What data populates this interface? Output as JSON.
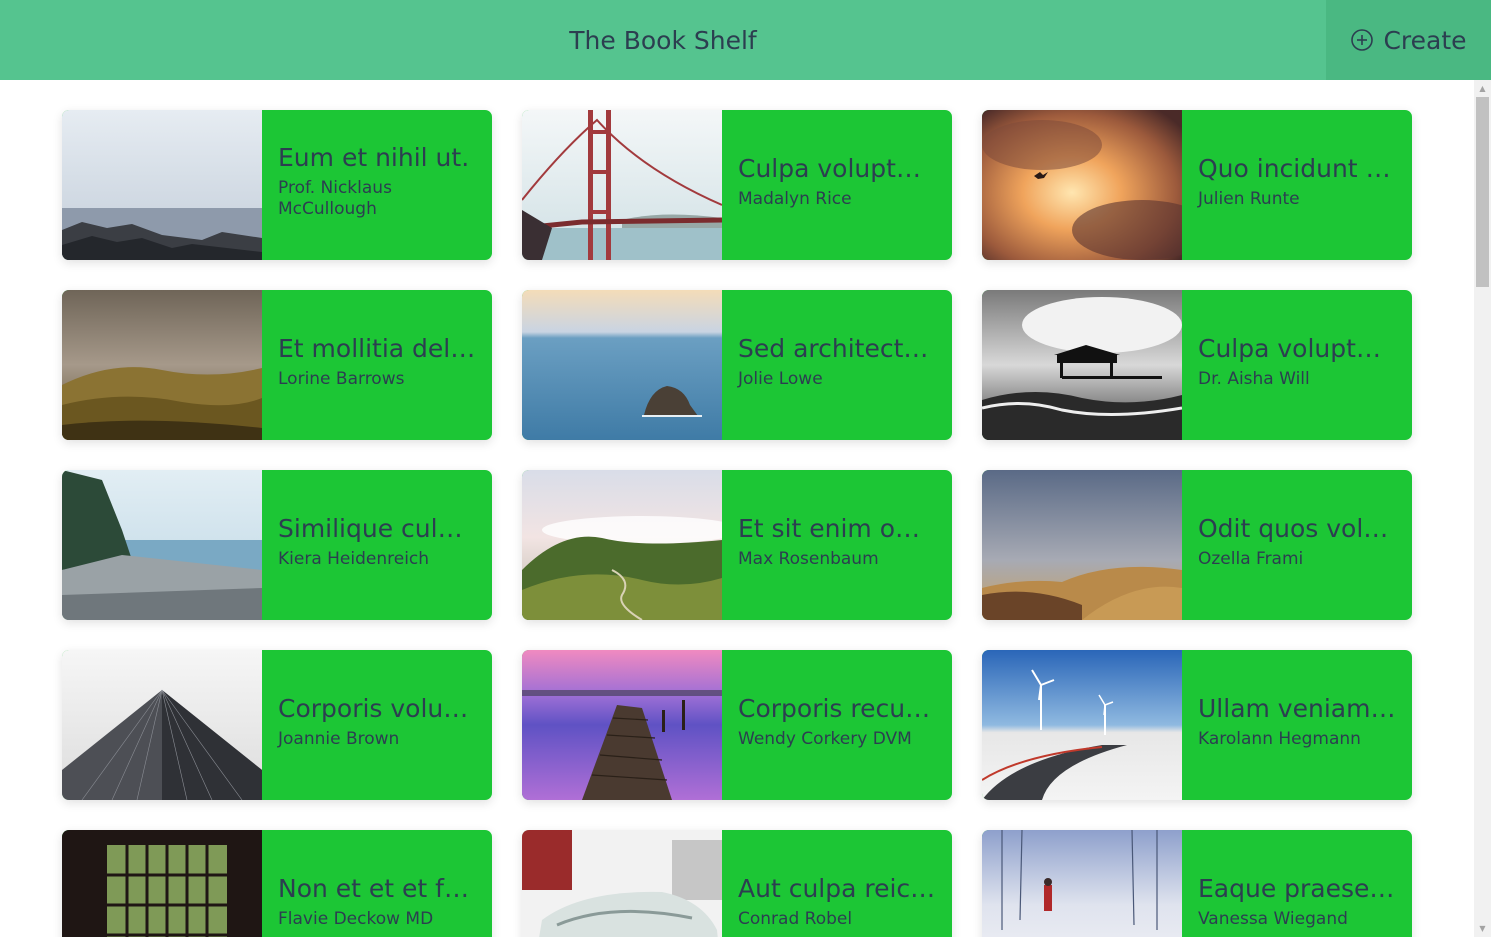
{
  "header": {
    "title": "The Book Shelf",
    "create_label": "Create",
    "background": "#55c48f",
    "create_background": "#4ab882"
  },
  "card_color": "#1cc635",
  "books": [
    {
      "title": "Eum et nihil ut.",
      "author": "Prof. Nicklaus McCullough",
      "image": "rocky-coast"
    },
    {
      "title": "Culpa voluptat...",
      "author": "Madalyn Rice",
      "image": "golden-gate-bridge"
    },
    {
      "title": "Quo incidunt a...",
      "author": "Julien Runte",
      "image": "sunset-clouds"
    },
    {
      "title": "Et mollitia dele...",
      "author": "Lorine Barrows",
      "image": "misty-hills"
    },
    {
      "title": "Sed architecto ...",
      "author": "Jolie Lowe",
      "image": "sea-rock"
    },
    {
      "title": "Culpa voluptati...",
      "author": "Dr. Aisha Will",
      "image": "pier-bw"
    },
    {
      "title": "Similique culpa...",
      "author": "Kiera Heidenreich",
      "image": "pebble-beach"
    },
    {
      "title": "Et sit enim om...",
      "author": "Max Rosenbaum",
      "image": "green-hills"
    },
    {
      "title": "Odit quos volu...",
      "author": "Ozella Frami",
      "image": "desert-hills"
    },
    {
      "title": "Corporis volup...",
      "author": "Joannie Brown",
      "image": "skyscraper"
    },
    {
      "title": "Corporis recus...",
      "author": "Wendy Corkery DVM",
      "image": "dock-sunset"
    },
    {
      "title": "Ullam veniam ...",
      "author": "Karolann Hegmann",
      "image": "wind-turbines-road"
    },
    {
      "title": "Non et et et fu...",
      "author": "Flavie Deckow MD",
      "image": "window-forest"
    },
    {
      "title": "Aut culpa reici...",
      "author": "Conrad Robel",
      "image": "vintage-car"
    },
    {
      "title": "Eaque praesen...",
      "author": "Vanessa Wiegand",
      "image": "snowy-forest"
    }
  ]
}
